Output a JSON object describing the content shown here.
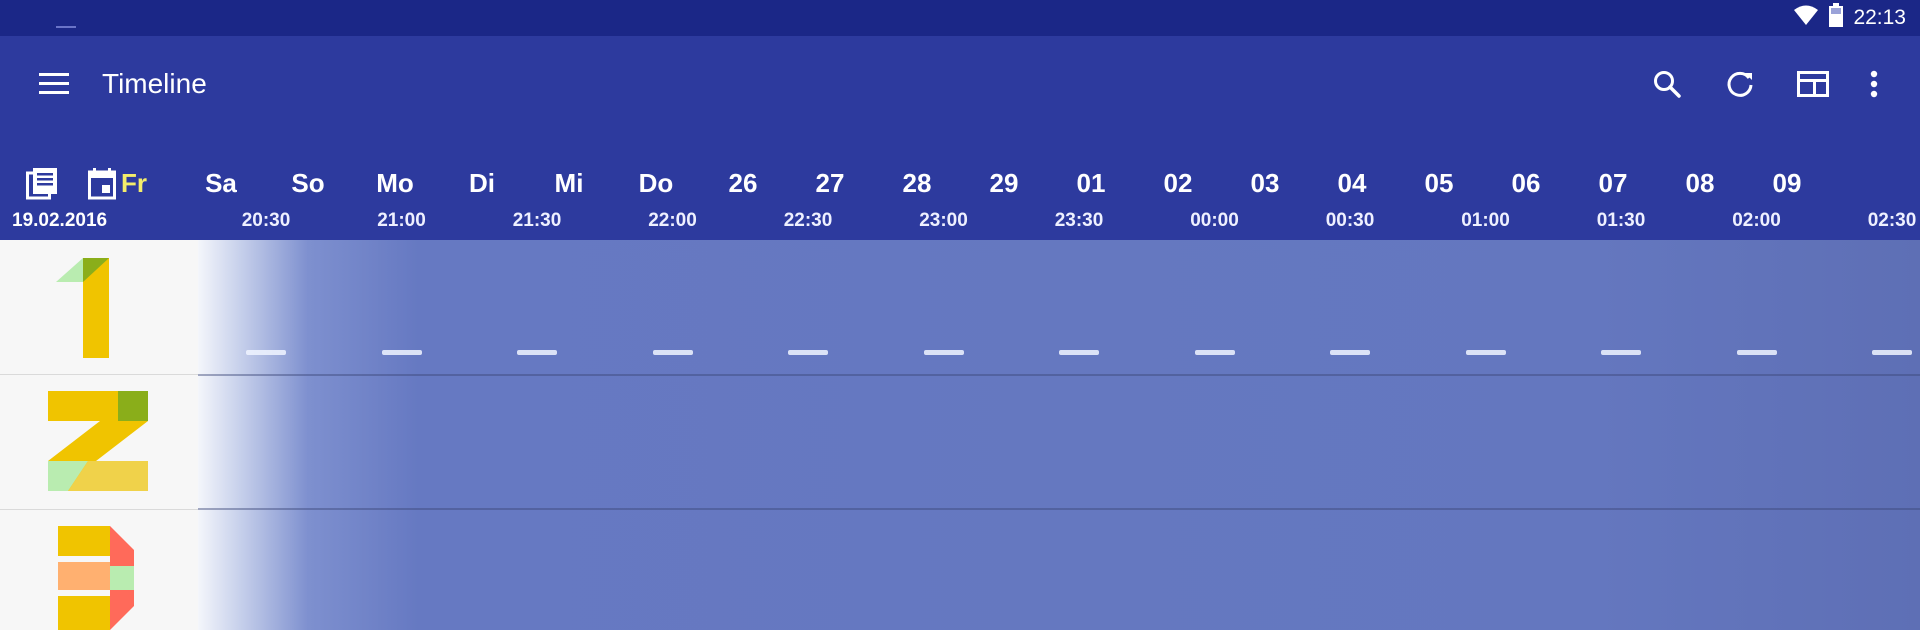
{
  "status_bar": {
    "time": "22:13",
    "wifi_icon": "wifi-icon",
    "battery_icon": "battery-icon"
  },
  "toolbar": {
    "title": "Timeline",
    "menu_icon": "menu-icon",
    "search_icon": "search-icon",
    "refresh_icon": "refresh-icon",
    "layout_icon": "view-layout-icon",
    "overflow_icon": "more-vert-icon"
  },
  "day_bar": {
    "guide_icon": "guide-list-icon",
    "calendar_icon": "calendar-icon",
    "days": [
      "Fr",
      "Sa",
      "So",
      "Mo",
      "Di",
      "Mi",
      "Do",
      "26",
      "27",
      "28",
      "29",
      "01",
      "02",
      "03",
      "04",
      "05",
      "06",
      "07",
      "08",
      "09"
    ],
    "selected": "Fr"
  },
  "time_ruler": {
    "date": "19.02.2016",
    "ticks": [
      "20:30",
      "21:00",
      "21:30",
      "22:00",
      "22:30",
      "23:00",
      "23:30",
      "00:00",
      "00:30",
      "01:00",
      "01:30",
      "02:00",
      "02:30"
    ]
  },
  "channels": [
    {
      "number": "1"
    },
    {
      "number": "2"
    },
    {
      "number": "3"
    }
  ],
  "colors": {
    "status_bar": "#1b2787",
    "toolbar": "#2d3a9e",
    "today_highlight": "#f4ed6b",
    "logo_yellow": "#f0c400"
  }
}
